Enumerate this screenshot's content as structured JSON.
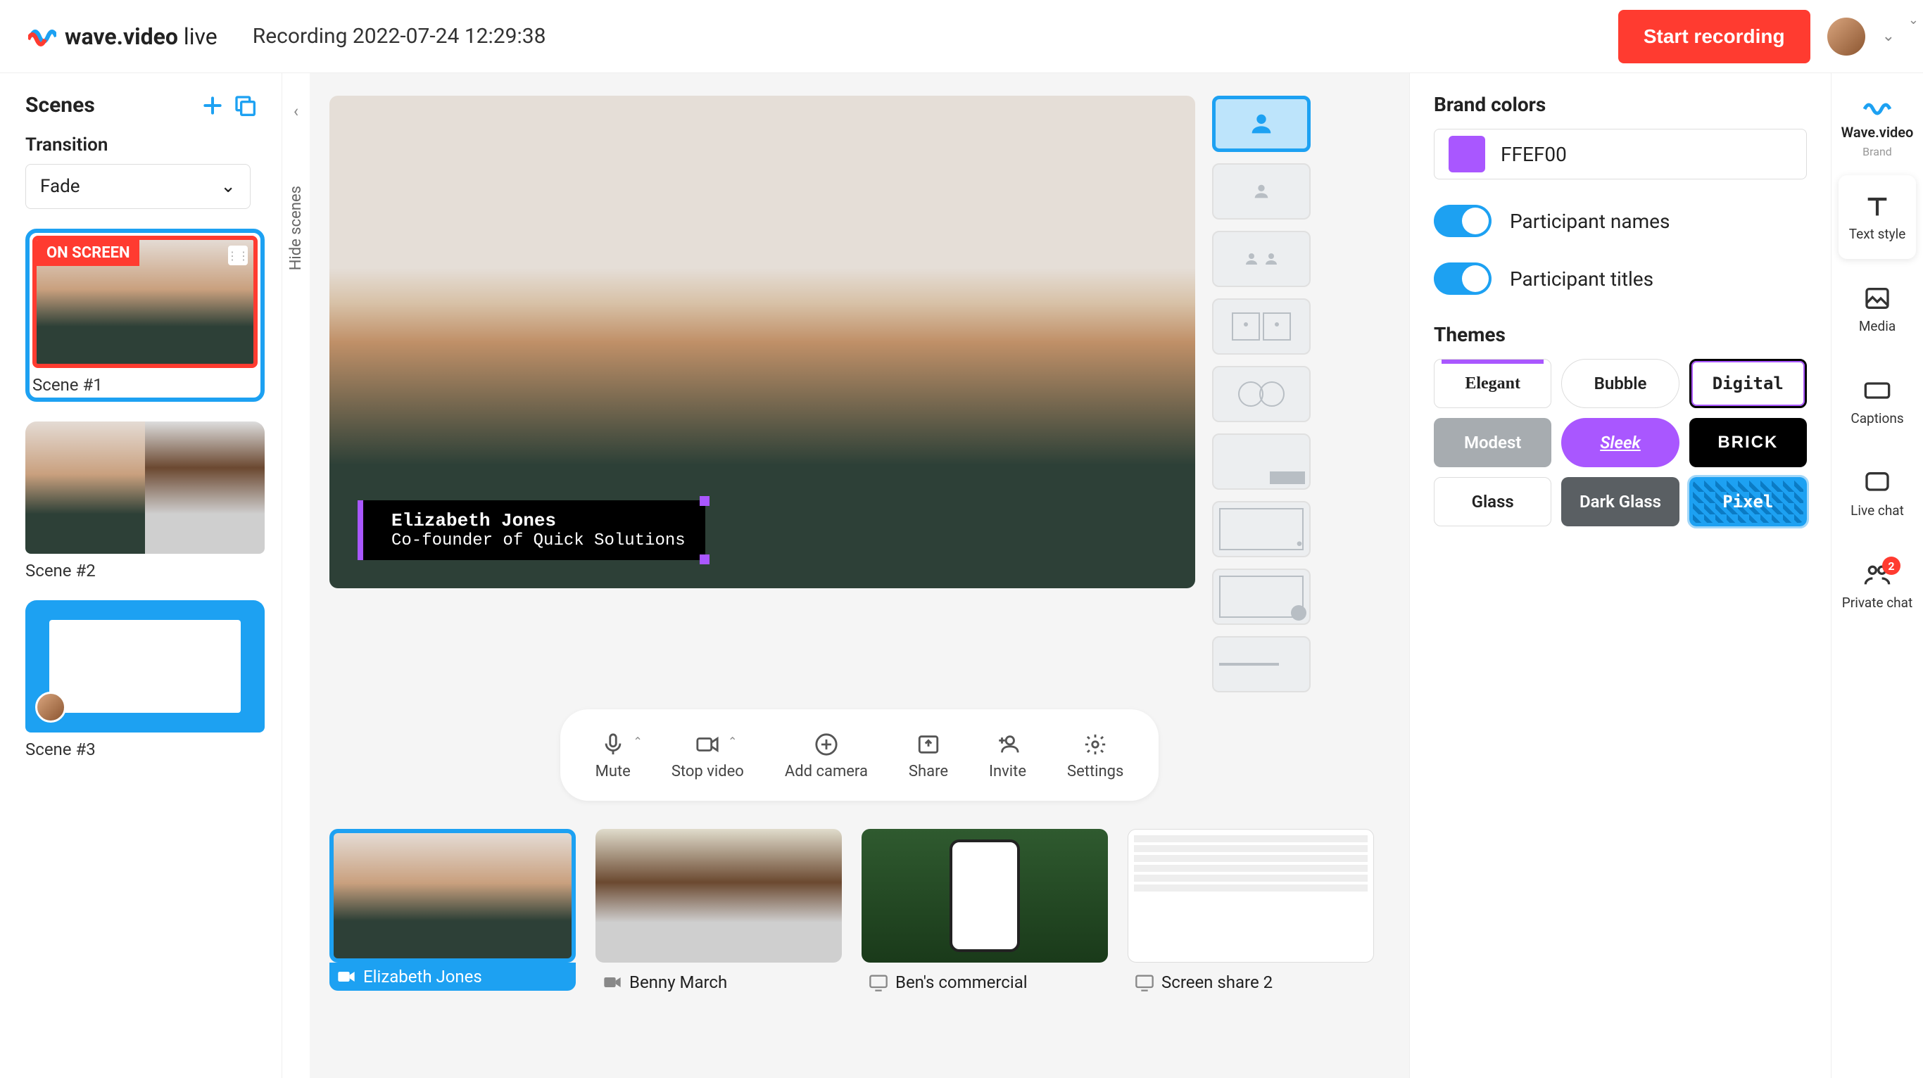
{
  "header": {
    "logo_text_bold": "wave.video",
    "logo_text_light": " live",
    "recording_title": "Recording 2022-07-24 12:29:38",
    "start_recording": "Start recording"
  },
  "scenes": {
    "title": "Scenes",
    "transition_label": "Transition",
    "transition_value": "Fade",
    "hide_label": "Hide scenes",
    "on_screen_badge": "ON SCREEN",
    "items": [
      {
        "name": "Scene #1"
      },
      {
        "name": "Scene #2"
      },
      {
        "name": "Scene #3"
      }
    ]
  },
  "lower_third": {
    "name": "Elizabeth Jones",
    "title": "Co-founder of Quick Solutions"
  },
  "controls": {
    "mute": "Mute",
    "stop_video": "Stop video",
    "add_camera": "Add camera",
    "share": "Share",
    "invite": "Invite",
    "settings": "Settings"
  },
  "sources": [
    {
      "label": "Elizabeth Jones",
      "type": "camera"
    },
    {
      "label": "Benny March",
      "type": "camera"
    },
    {
      "label": "Ben's commercial",
      "type": "screen"
    },
    {
      "label": "Screen share 2",
      "type": "screen"
    }
  ],
  "right_panel": {
    "brand_colors_label": "Brand colors",
    "color_value": "FFEF00",
    "participant_names": "Participant names",
    "participant_titles": "Participant titles",
    "themes_label": "Themes",
    "themes": {
      "elegant": "Elegant",
      "bubble": "Bubble",
      "digital": "Digital",
      "modest": "Modest",
      "sleek": "Sleek",
      "brick": "BRICK",
      "glass": "Glass",
      "darkglass": "Dark Glass",
      "pixel": "Pixel"
    }
  },
  "rail": {
    "brand_name": "Wave.video",
    "brand_sub": "Brand",
    "text_style": "Text style",
    "media": "Media",
    "captions": "Captions",
    "live_chat": "Live chat",
    "private_chat": "Private chat",
    "private_chat_badge": "2"
  }
}
